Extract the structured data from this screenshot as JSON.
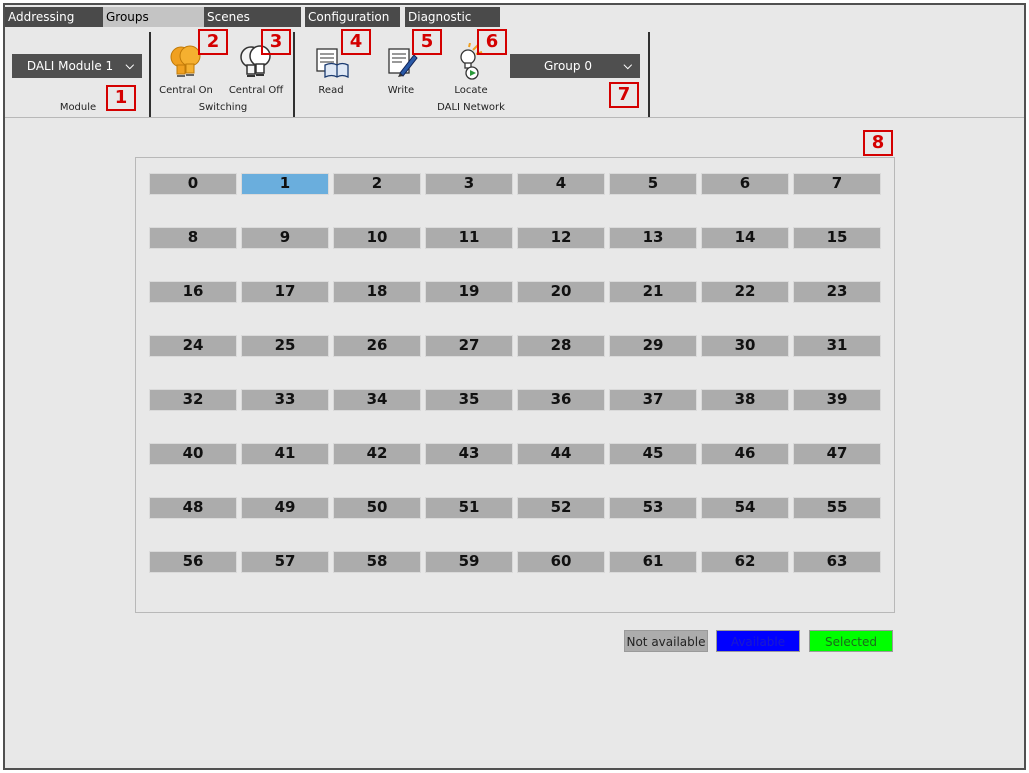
{
  "tabs": [
    {
      "label": "Addressing",
      "active": false
    },
    {
      "label": "Groups",
      "active": true
    },
    {
      "label": "Scenes",
      "active": false
    },
    {
      "label": "Configuration",
      "active": false
    },
    {
      "label": "Diagnostic",
      "active": false
    }
  ],
  "ribbon": {
    "module_dropdown": "DALI Module 1",
    "module_group_label": "Module",
    "central_on": "Central On",
    "central_off": "Central Off",
    "switching_group_label": "Switching",
    "read": "Read",
    "write": "Write",
    "locate": "Locate",
    "group_dropdown": "Group 0",
    "network_group_label": "DALI Network"
  },
  "callouts": [
    "1",
    "2",
    "3",
    "4",
    "5",
    "6",
    "7",
    "8"
  ],
  "addresses": {
    "selected": [
      1
    ],
    "cells": [
      "0",
      "1",
      "2",
      "3",
      "4",
      "5",
      "6",
      "7",
      "8",
      "9",
      "10",
      "11",
      "12",
      "13",
      "14",
      "15",
      "16",
      "17",
      "18",
      "19",
      "20",
      "21",
      "22",
      "23",
      "24",
      "25",
      "26",
      "27",
      "28",
      "29",
      "30",
      "31",
      "32",
      "33",
      "34",
      "35",
      "36",
      "37",
      "38",
      "39",
      "40",
      "41",
      "42",
      "43",
      "44",
      "45",
      "46",
      "47",
      "48",
      "49",
      "50",
      "51",
      "52",
      "53",
      "54",
      "55",
      "56",
      "57",
      "58",
      "59",
      "60",
      "61",
      "62",
      "63"
    ]
  },
  "legend": [
    {
      "label": "Not available",
      "color": "#acacac",
      "text_color": "#222222"
    },
    {
      "label": "Available",
      "color": "#0000ff",
      "text_color": "#1a1acc"
    },
    {
      "label": "Selected",
      "color": "#00ff00",
      "text_color": "#1a6a1a"
    }
  ],
  "colors": {
    "selected_cell": "#6aaedd",
    "cell": "#acacac",
    "callout": "#d40000"
  }
}
